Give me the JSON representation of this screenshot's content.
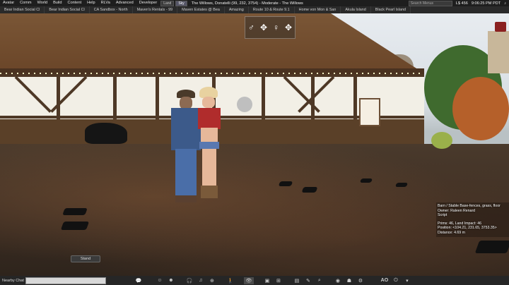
{
  "menubar": {
    "items": [
      "Avatar",
      "Comm",
      "World",
      "Build",
      "Content",
      "Help",
      "RLVa",
      "Advanced",
      "Developer"
    ],
    "location": "The Willows, Donatelli (99, 232, 3754) - Moderate - The Willows",
    "search_buttons": [
      "Land",
      "Sky"
    ],
    "search_placeholder": "Search Menus",
    "balance": "L$ 456",
    "time": "9:06:25 PM PDT"
  },
  "favorites": [
    "Bear Indian Social Cl",
    "Bear Indian Social Cl",
    "CA Sandbox - North",
    "Maven's Rentals - 99",
    "Maven Estates @ Bea",
    "Amazing",
    "Route 10 & Route 9.1",
    "Home von Mon & San",
    "Akula Island",
    "Black Pearl Island"
  ],
  "hover_info": {
    "title": "Barn / Stable Base-fences, grass, floor",
    "owner": "Owner: Raleen Renard",
    "script": "Script",
    "prims": "Prims: 46, Land Impact: 46",
    "position": "Position: <104.21, 231.65, 3753.35>",
    "distance": "Distance: 4.69 m"
  },
  "stand_button": "Stand",
  "chat": {
    "label": "Nearby Chat"
  },
  "toolbar_icons": [
    "speak-icon",
    "chat-icon",
    "people-icon",
    "places-icon",
    "voice-icon",
    "camera-icon",
    "walk-icon",
    "fly-icon",
    "view-icon",
    "map-icon",
    "minimap-icon",
    "inventory-icon",
    "build-icon",
    "search-icon",
    "snapshot-icon",
    "appearance-icon",
    "settings-icon"
  ],
  "ao_label": "AO",
  "colors": {
    "menubar": "#1e1e1e",
    "bottombar": "#262626",
    "accent": "#556"
  }
}
